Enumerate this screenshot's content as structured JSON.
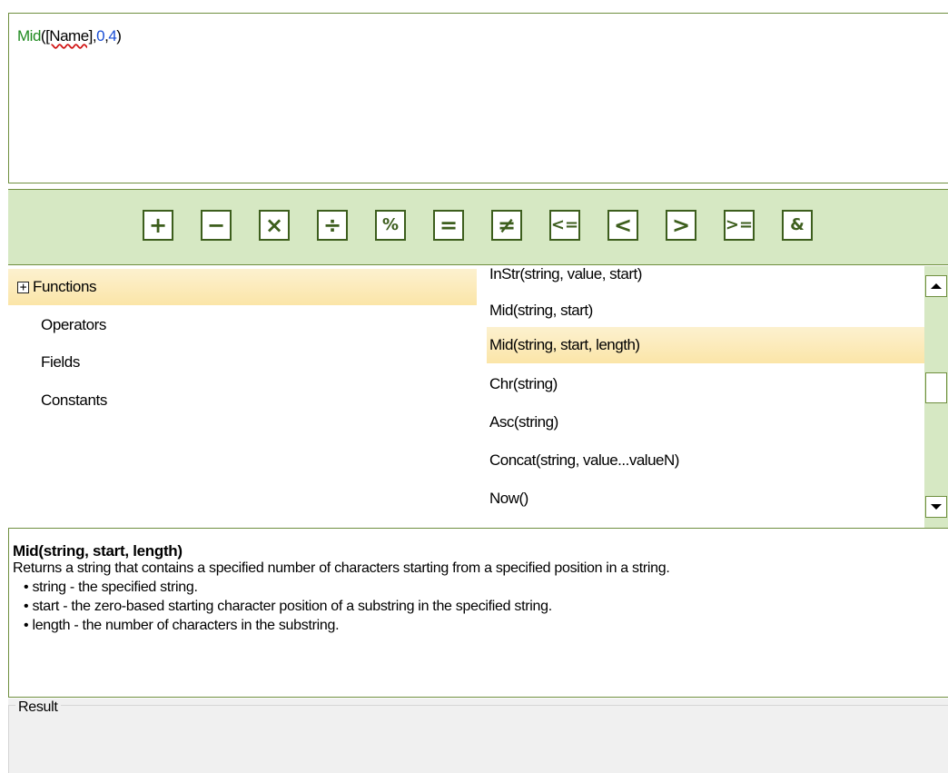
{
  "expression": {
    "function": "Mid",
    "open": "(",
    "field": "[Name]",
    "comma1": ",",
    "arg1": "0",
    "comma2": ",",
    "arg2": "4",
    "close": ")"
  },
  "toolbar": {
    "operators": [
      {
        "name": "plus",
        "glyph": "+"
      },
      {
        "name": "minus",
        "glyph": "−"
      },
      {
        "name": "multiply",
        "glyph": "×"
      },
      {
        "name": "divide",
        "glyph": "÷"
      },
      {
        "name": "modulo",
        "glyph": "%"
      },
      {
        "name": "equals",
        "glyph": "="
      },
      {
        "name": "not-equals",
        "glyph": "≠"
      },
      {
        "name": "less-or-equal",
        "glyph": "<="
      },
      {
        "name": "less-than",
        "glyph": "<"
      },
      {
        "name": "greater-than",
        "glyph": ">"
      },
      {
        "name": "greater-or-equal",
        "glyph": ">="
      },
      {
        "name": "concatenate",
        "glyph": "&"
      }
    ]
  },
  "categories": {
    "items": [
      {
        "label": "Functions",
        "expander": "+",
        "selected": true
      },
      {
        "label": "Operators"
      },
      {
        "label": "Fields"
      },
      {
        "label": "Constants"
      }
    ]
  },
  "functions": {
    "items": [
      {
        "label": "InStr(string, value, start)"
      },
      {
        "label": "Mid(string, start)"
      },
      {
        "label": "Mid(string, start, length)",
        "selected": true
      },
      {
        "label": "Chr(string)"
      },
      {
        "label": "Asc(string)"
      },
      {
        "label": "Concat(string, value...valueN)"
      },
      {
        "label": "Now()"
      }
    ]
  },
  "description": {
    "title": "Mid(string, start, length)",
    "text": "Returns a string that contains a specified number of characters starting from a specified position in a string.",
    "bullets": [
      "• string - the specified string.",
      "• start - the zero-based starting character position of a substring in the specified string.",
      "• length - the number of characters in the substring."
    ]
  },
  "result": {
    "label": "Result"
  },
  "colors": {
    "toolbar_bg": "#d6e8c3",
    "border": "#6f8f3f",
    "button_border": "#3d5e1d",
    "selection": "#fbe5a8",
    "function_color": "#1f8a1f",
    "number_color": "#1a4fd6"
  }
}
